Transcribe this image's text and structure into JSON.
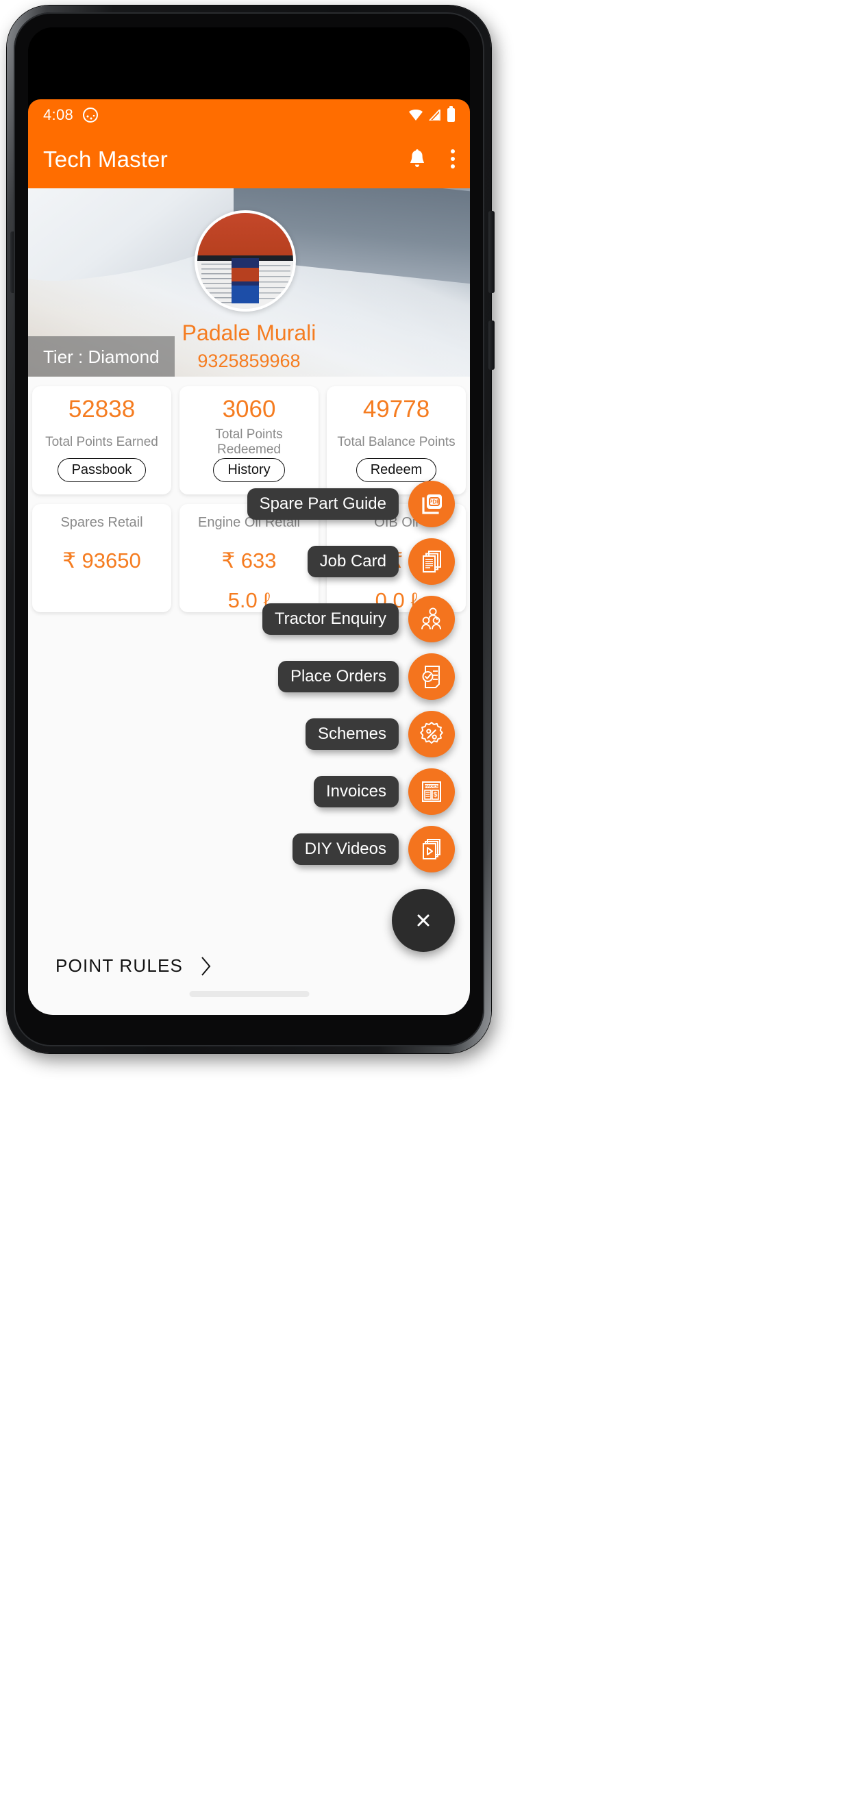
{
  "status_bar": {
    "time": "4:08",
    "app_icon": "cat-app-icon",
    "icons": [
      "wifi-icon",
      "signal-icon",
      "battery-icon"
    ]
  },
  "app_bar": {
    "title": "Tech Master",
    "notification_icon": "bell-icon",
    "overflow_icon": "kebab-menu-icon"
  },
  "profile": {
    "name": "Padale Murali",
    "phone": "9325859968",
    "tier_label": "Tier : Diamond",
    "avatar": "user-avatar-photo"
  },
  "stat_cards": [
    {
      "value": "52838",
      "label": "Total Points Earned",
      "action": "Passbook"
    },
    {
      "value": "3060",
      "label": "Total Points Redeemed",
      "action": "History"
    },
    {
      "value": "49778",
      "label": "Total Balance Points",
      "action": "Redeem"
    }
  ],
  "retail_cards": [
    {
      "title": "Spares Retail",
      "amount": "₹ 93650",
      "volume": ""
    },
    {
      "title": "Engine Oil Retail",
      "amount": "₹ 633",
      "volume": "5.0 ℓ"
    },
    {
      "title": "OIB Oil",
      "amount": "₹",
      "volume": "0.0 ℓ"
    }
  ],
  "point_rules": {
    "label": "POINT RULES",
    "chevron": "chevron-right-icon"
  },
  "fab_menu": {
    "items": [
      {
        "label": "Spare Part Guide",
        "icon": "pdf-document-icon"
      },
      {
        "label": "Job Card",
        "icon": "stacked-documents-icon"
      },
      {
        "label": "Tractor Enquiry",
        "icon": "people-group-icon"
      },
      {
        "label": "Place Orders",
        "icon": "order-checklist-icon"
      },
      {
        "label": "Schemes",
        "icon": "percent-badge-icon"
      },
      {
        "label": "Invoices",
        "icon": "invoice-icon"
      },
      {
        "label": "DIY Videos",
        "icon": "video-stack-icon"
      }
    ],
    "close_label": "×",
    "close_icon": "close-icon"
  },
  "colors": {
    "brand_orange": "#FF6D00",
    "accent_orange": "#F57C20",
    "fab_orange": "#F4741E",
    "label_dark": "#3A3A3A",
    "muted_text": "#8A8A8A"
  }
}
